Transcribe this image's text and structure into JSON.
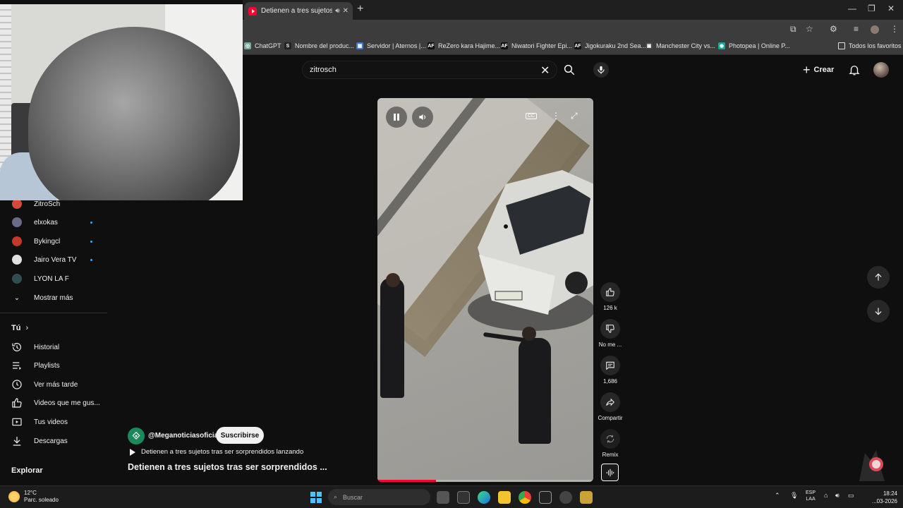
{
  "browser": {
    "tab_title": "Detienen a tres sujetos tras",
    "new_tab": "+",
    "bookmarks": [
      {
        "label": "ChatGPT",
        "color": "#74aa9c",
        "mark": "◎"
      },
      {
        "label": "Nombre del produc...",
        "color": "#222222",
        "mark": "S"
      },
      {
        "label": "Servidor | Aternos |...",
        "color": "#3a7bd5",
        "mark": "▦"
      },
      {
        "label": "ReZero kara Hajime...",
        "color": "#111111",
        "mark": "AF"
      },
      {
        "label": "Niwatori Fighter Epi...",
        "color": "#111111",
        "mark": "AF"
      },
      {
        "label": "Jigokuraku 2nd Sea...",
        "color": "#111111",
        "mark": "AF"
      },
      {
        "label": "Manchester City vs...",
        "color": "#444444",
        "mark": "▣"
      },
      {
        "label": "Photopea | Online P...",
        "color": "#18a497",
        "mark": "◉"
      }
    ],
    "all_bookmarks": "Todos los favoritos"
  },
  "youtube": {
    "search_value": "zitrosch",
    "create_label": "Crear"
  },
  "sidebar": {
    "subscriptions": [
      {
        "label": "ZitroSch",
        "color": "#d44a3a",
        "live": false
      },
      {
        "label": "elxokas",
        "color": "#6a6a8a",
        "live": true
      },
      {
        "label": "Bykingcl",
        "color": "#c0392b",
        "live": true
      },
      {
        "label": "Jairo Vera TV",
        "color": "#e0e0e0",
        "live": true
      },
      {
        "label": "LYON LA F",
        "color": "#2f4f4f",
        "live": false
      }
    ],
    "show_more": "Mostrar más",
    "you_title": "Tú",
    "you_items": [
      {
        "label": "Historial",
        "icon": "history-icon"
      },
      {
        "label": "Playlists",
        "icon": "playlists-icon"
      },
      {
        "label": "Ver más tarde",
        "icon": "clock-icon"
      },
      {
        "label": "Videos que me gus...",
        "icon": "thumbs-up-icon"
      },
      {
        "label": "Tus videos",
        "icon": "video-icon"
      },
      {
        "label": "Descargas",
        "icon": "download-icon"
      }
    ],
    "explore_title": "Explorar"
  },
  "short": {
    "channel": "@Meganoticiasoficial",
    "subscribe": "Suscribirse",
    "sound_text": "Detienen a tres sujetos tras ser sorprendidos lanzando",
    "title": "Detienen a tres sujetos tras ser sorprendidos ...",
    "progress": 0.27,
    "likes": "126 k",
    "dislike_label": "No me ...",
    "comments": "1,686",
    "share_label": "Compartir",
    "remix_label": "Remix"
  },
  "taskbar": {
    "temp": "12°C",
    "weather": "Parc. soleado",
    "search_placeholder": "Buscar",
    "lang1": "ESP",
    "lang2": "LAA",
    "time": "18:24",
    "date": "...03-2026"
  }
}
